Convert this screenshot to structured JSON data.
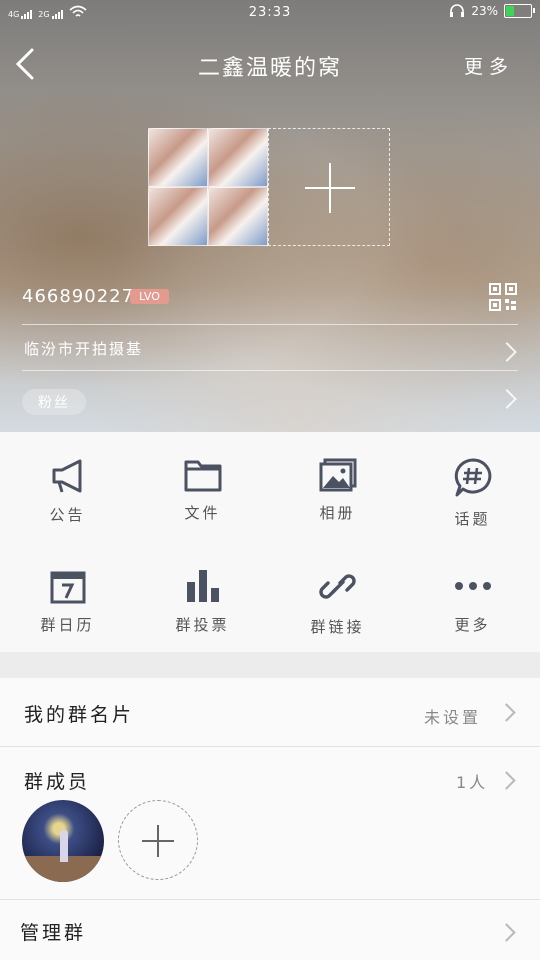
{
  "status_bar": {
    "network_1": "4G",
    "network_2": "2G",
    "time": "23:33",
    "battery": "23%"
  },
  "header": {
    "title": "二鑫温暖的窝",
    "more": "更多"
  },
  "group": {
    "id": "466890227",
    "level": "LVO",
    "location": "临汾市开拍摄基",
    "fans_tag": "粉丝"
  },
  "grid": [
    {
      "label": "公告",
      "icon": "megaphone-icon"
    },
    {
      "label": "文件",
      "icon": "folder-icon"
    },
    {
      "label": "相册",
      "icon": "photo-album-icon"
    },
    {
      "label": "话题",
      "icon": "hashtag-icon"
    },
    {
      "label": "群日历",
      "icon": "calendar-icon",
      "day": "7"
    },
    {
      "label": "群投票",
      "icon": "bar-chart-icon"
    },
    {
      "label": "群链接",
      "icon": "link-icon"
    },
    {
      "label": "更多",
      "icon": "more-dots-icon"
    }
  ],
  "settings": {
    "card_label": "我的群名片",
    "card_value": "未设置",
    "members_label": "群成员",
    "members_count": "1人",
    "manage_label": "管理群"
  },
  "colors": {
    "icon": "#4b5262",
    "level_badge": "#e49a8f",
    "battery_fill": "#3fd35a"
  }
}
